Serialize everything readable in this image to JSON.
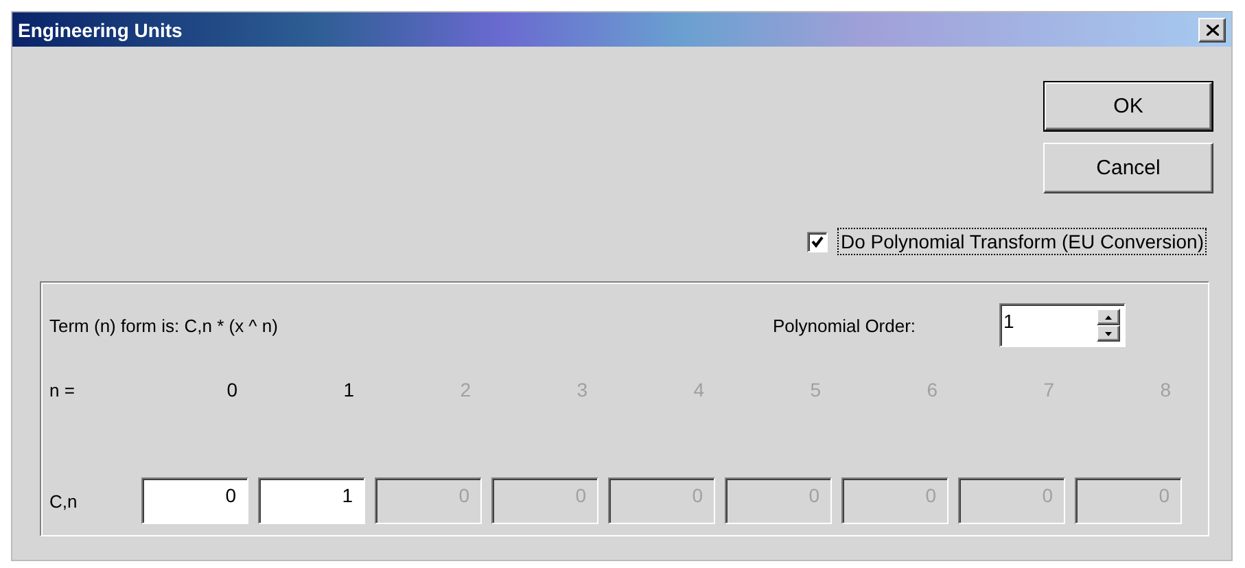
{
  "window": {
    "title": "Engineering Units"
  },
  "buttons": [
    {
      "label": "OK",
      "default": true
    },
    {
      "label": "Cancel",
      "default": false
    }
  ],
  "transform_checkbox": {
    "label": "Do Polynomial Transform (EU Conversion)",
    "checked": true
  },
  "coefficients": {
    "formula_label": "Term (n) form is: C,n * (x ^ n)",
    "order_label": "Polynomial Order:",
    "order_value": "1",
    "n_label": "n =",
    "c_label": "C,n",
    "terms": [
      {
        "n": "0",
        "value": "0",
        "disabled": false
      },
      {
        "n": "1",
        "value": "1",
        "disabled": false
      },
      {
        "n": "2",
        "value": "0",
        "disabled": true
      },
      {
        "n": "3",
        "value": "0",
        "disabled": true
      },
      {
        "n": "4",
        "value": "0",
        "disabled": true
      },
      {
        "n": "5",
        "value": "0",
        "disabled": true
      },
      {
        "n": "6",
        "value": "0",
        "disabled": true
      },
      {
        "n": "7",
        "value": "0",
        "disabled": true
      },
      {
        "n": "8",
        "value": "0",
        "disabled": true
      }
    ]
  }
}
